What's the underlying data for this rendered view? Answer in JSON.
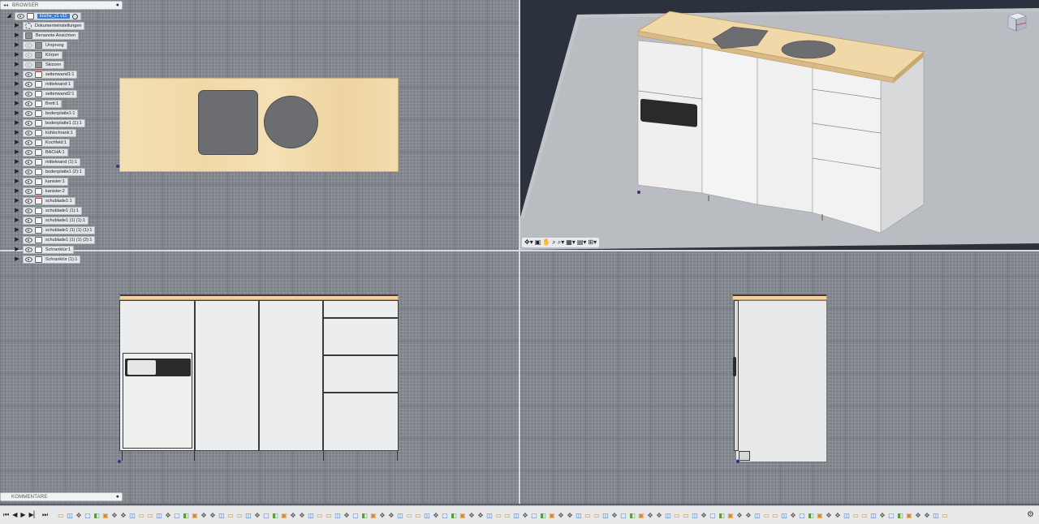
{
  "browser": {
    "header_label": "BROWSER",
    "pin_icon": "double-arrow-left-icon",
    "root": {
      "name": "küche_v1 v11"
    },
    "items": [
      {
        "label": "Dokumenteinstellungen",
        "icon": "gear-icon",
        "eye": false
      },
      {
        "label": "Benannte Ansichten",
        "icon": "folder-icon",
        "eye": false
      },
      {
        "label": "Ursprung",
        "icon": "folder-icon",
        "eye": true,
        "eye_off": true
      },
      {
        "label": "Körper",
        "icon": "folder-icon",
        "eye": true,
        "eye_off": true
      },
      {
        "label": "Skizzen",
        "icon": "folder-icon",
        "eye": true,
        "eye_off": true
      },
      {
        "label": "seitenwand1:1",
        "icon": "component-active-icon",
        "eye": true
      },
      {
        "label": "mittelwand:1",
        "icon": "component-icon",
        "eye": true
      },
      {
        "label": "seitenwand2:1",
        "icon": "component-icon",
        "eye": true
      },
      {
        "label": "Brett:1",
        "icon": "component-icon",
        "eye": true
      },
      {
        "label": "bodenplatte1:1",
        "icon": "component-icon",
        "eye": true
      },
      {
        "label": "bodenplatte1 (1):1",
        "icon": "component-icon",
        "eye": true
      },
      {
        "label": "kühlschrank:1",
        "icon": "component-icon",
        "eye": true
      },
      {
        "label": "Kochfeld:1",
        "icon": "component-icon",
        "eye": true
      },
      {
        "label": "BACHA:1",
        "icon": "component-icon",
        "eye": true
      },
      {
        "label": "mittelwand (1):1",
        "icon": "component-icon",
        "eye": true
      },
      {
        "label": "bodenplatte1 (2):1",
        "icon": "component-icon",
        "eye": true
      },
      {
        "label": "kanister:1",
        "icon": "component-icon",
        "eye": true
      },
      {
        "label": "kanister:2",
        "icon": "component-icon",
        "eye": true
      },
      {
        "label": "schublade1:1",
        "icon": "component-joint-red-icon",
        "eye": true
      },
      {
        "label": "schublade1 (1):1",
        "icon": "component-joint-icon",
        "eye": true
      },
      {
        "label": "schublade1 (1) (1):1",
        "icon": "component-joint-icon",
        "eye": true
      },
      {
        "label": "schublade1 (1) (1) (1):1",
        "icon": "component-joint-icon",
        "eye": true
      },
      {
        "label": "schublade1 (1) (1) (2):1",
        "icon": "component-joint-icon",
        "eye": true
      },
      {
        "label": "Schranktür:1",
        "icon": "component-icon",
        "eye": true
      },
      {
        "label": "Schranktür (1):1",
        "icon": "component-icon",
        "eye": true
      }
    ]
  },
  "comments": {
    "header_label": "KOMMENTARE"
  },
  "colors": {
    "countertop": "#f1d9a6",
    "cabinet": "#ecedee",
    "cooktop": "#6c6d70",
    "viewport_grid": "#7d8189",
    "perspective_bg": "#2b323d",
    "selection_blue": "#3a7bd5"
  },
  "nav_toolbar_icons": [
    "orbit-icon",
    "look-at-icon",
    "pan-icon",
    "zoom-icon",
    "zoom-window-icon",
    "display-style-icon",
    "grid-icon",
    "viewports-icon"
  ],
  "timeline": {
    "controls": [
      "first-icon",
      "previous-icon",
      "play-icon",
      "next-icon",
      "last-icon"
    ],
    "settings_icon": "gear-icon"
  }
}
